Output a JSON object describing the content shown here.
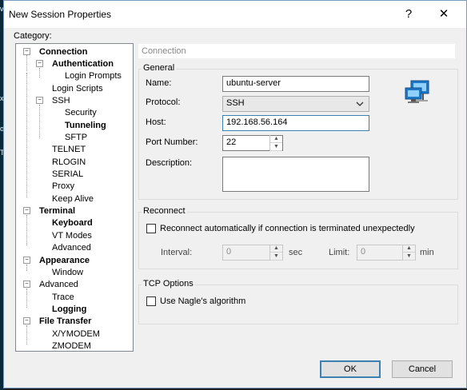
{
  "background": {
    "left_chars": [
      "v",
      "x",
      "o",
      "e",
      "T"
    ]
  },
  "window": {
    "title": "New Session Properties",
    "help_label": "?",
    "close_label": "✕"
  },
  "category": {
    "label": "Category:",
    "items": [
      {
        "label": "Connection",
        "bold": true,
        "expanded": true
      },
      {
        "label": "Authentication",
        "bold": true,
        "expanded": true
      },
      {
        "label": "Login Prompts",
        "bold": false
      },
      {
        "label": "Login Scripts",
        "bold": false
      },
      {
        "label": "SSH",
        "bold": false,
        "expanded": true
      },
      {
        "label": "Security",
        "bold": false
      },
      {
        "label": "Tunneling",
        "bold": true
      },
      {
        "label": "SFTP",
        "bold": false
      },
      {
        "label": "TELNET",
        "bold": false
      },
      {
        "label": "RLOGIN",
        "bold": false
      },
      {
        "label": "SERIAL",
        "bold": false
      },
      {
        "label": "Proxy",
        "bold": false
      },
      {
        "label": "Keep Alive",
        "bold": false
      },
      {
        "label": "Terminal",
        "bold": true,
        "expanded": true
      },
      {
        "label": "Keyboard",
        "bold": true
      },
      {
        "label": "VT Modes",
        "bold": false
      },
      {
        "label": "Advanced",
        "bold": false
      },
      {
        "label": "Appearance",
        "bold": true,
        "expanded": true
      },
      {
        "label": "Window",
        "bold": false
      },
      {
        "label": "Advanced",
        "bold": false,
        "expanded": true
      },
      {
        "label": "Trace",
        "bold": false
      },
      {
        "label": "Logging",
        "bold": true
      },
      {
        "label": "File Transfer",
        "bold": true,
        "expanded": true
      },
      {
        "label": "X/YMODEM",
        "bold": false
      },
      {
        "label": "ZMODEM",
        "bold": false
      }
    ]
  },
  "panel": {
    "header": "Connection",
    "general": {
      "title": "General",
      "name_label": "Name:",
      "name_value": "ubuntu-server",
      "protocol_label": "Protocol:",
      "protocol_value": "SSH",
      "host_label": "Host:",
      "host_value": "192.168.56.164",
      "port_label": "Port Number:",
      "port_value": "22",
      "description_label": "Description:",
      "description_value": ""
    },
    "reconnect": {
      "title": "Reconnect",
      "auto_label": "Reconnect automatically if connection is terminated unexpectedly",
      "auto_checked": false,
      "interval_label": "Interval:",
      "interval_value": "0",
      "sec_label": "sec",
      "limit_label": "Limit:",
      "limit_value": "0",
      "min_label": "min"
    },
    "tcp": {
      "title": "TCP Options",
      "nagle_label": "Use Nagle's algorithm",
      "nagle_checked": false
    }
  },
  "buttons": {
    "ok": "OK",
    "cancel": "Cancel"
  },
  "colors": {
    "focus_border": "#3c7fb1",
    "icon_blue": "#1e78c8"
  }
}
